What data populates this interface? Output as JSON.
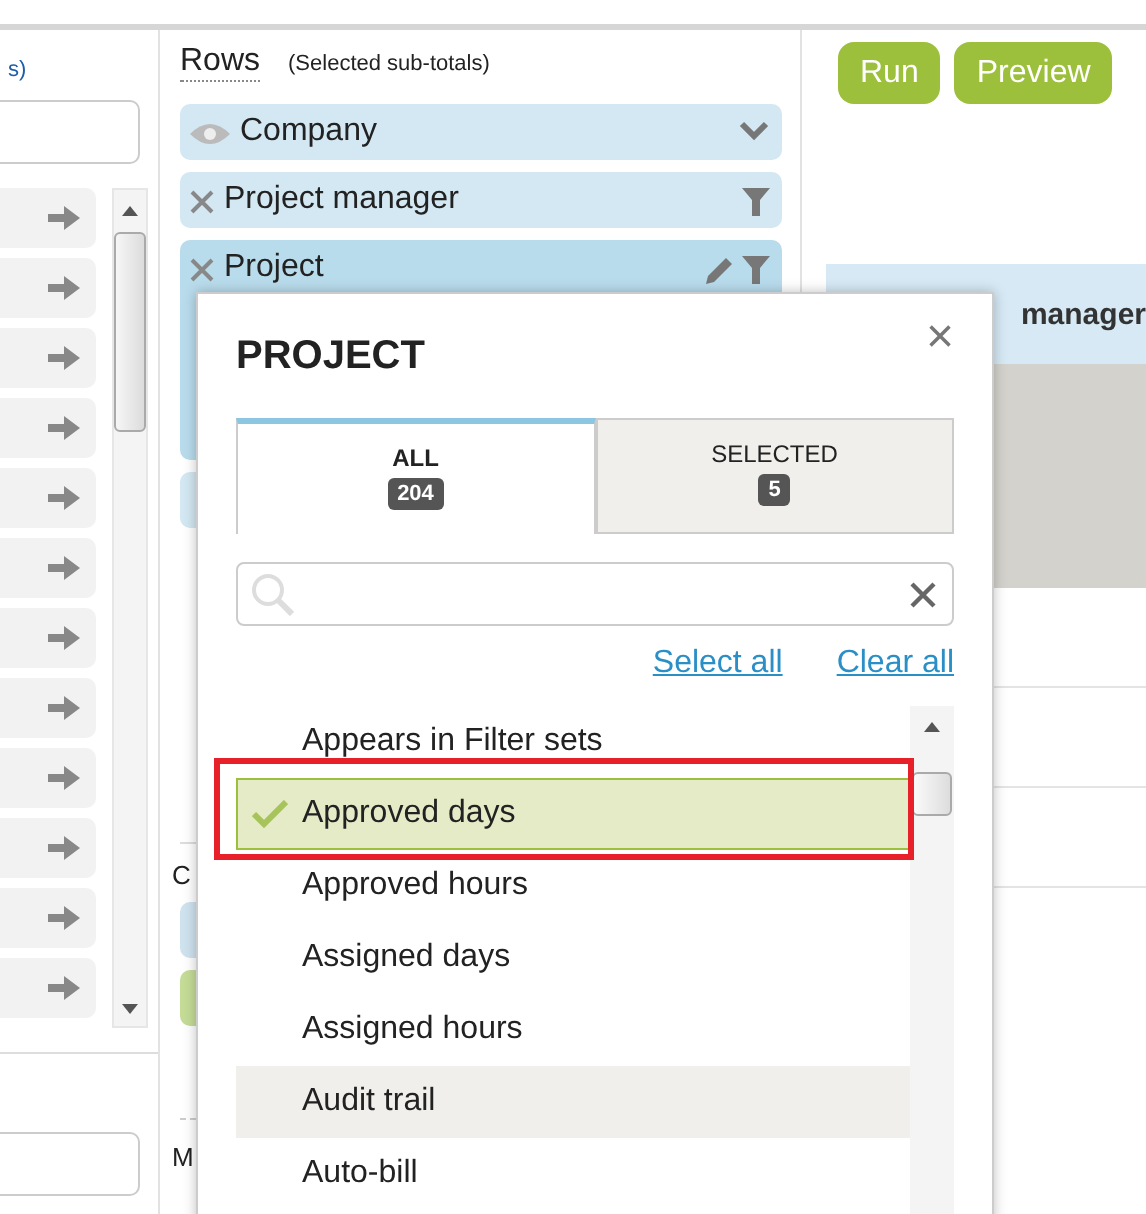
{
  "left_panel": {
    "caption": "s)"
  },
  "rows_section": {
    "title": "Rows",
    "note": "(Selected sub-totals)",
    "items": [
      {
        "label": "Company",
        "kind": "visible",
        "selected": false
      },
      {
        "label": "Project manager",
        "kind": "filter",
        "selected": false
      },
      {
        "label": "Project",
        "kind": "editable",
        "selected": true
      }
    ]
  },
  "lower_section": {
    "heading": "C",
    "footer_heading": "M"
  },
  "toolbar": {
    "buttons": [
      "Run",
      "Preview"
    ]
  },
  "table": {
    "header": "manager"
  },
  "popup": {
    "title": "PROJECT",
    "close": "×",
    "tabs": [
      {
        "label": "ALL",
        "count": "204",
        "selected": true
      },
      {
        "label": "SELECTED",
        "count": "5",
        "selected": false
      }
    ],
    "links": [
      "Select all",
      "Clear all"
    ],
    "items": [
      {
        "label": "Appears in Filter sets",
        "checked": false,
        "hovered": false
      },
      {
        "label": "Approved days",
        "checked": true,
        "hovered": false
      },
      {
        "label": "Approved hours",
        "checked": false,
        "hovered": false
      },
      {
        "label": "Assigned days",
        "checked": false,
        "hovered": false
      },
      {
        "label": "Assigned hours",
        "checked": false,
        "hovered": false
      },
      {
        "label": "Audit trail",
        "checked": false,
        "hovered": true
      },
      {
        "label": "Auto-bill",
        "checked": false,
        "hovered": false
      }
    ]
  }
}
